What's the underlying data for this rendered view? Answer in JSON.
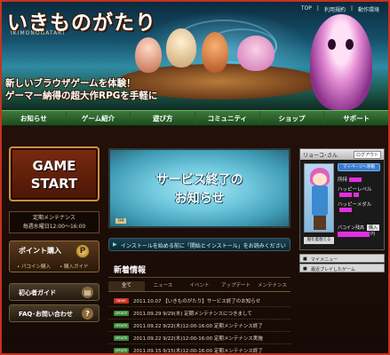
{
  "header": {
    "logo": "いきものがたり",
    "logo_sub": "IKIMONOGATARI",
    "top_links": [
      "TOP",
      "利用規約",
      "動作環境"
    ],
    "tagline1": "新しいブラウザゲームを体験！",
    "tagline2": "ゲーマー納得の超大作RPGを手軽に"
  },
  "nav": [
    "お知らせ",
    "ゲーム紹介",
    "遊び方",
    "コミュニティ",
    "ショップ",
    "サポート"
  ],
  "left": {
    "game_start_line1": "GAME",
    "game_start_line2": "START",
    "maintenance_title": "定期メンテナンス",
    "maintenance_time": "毎週水曜日12:00〜16:00",
    "point_label": "ポイント購入",
    "point_icon": "P",
    "point_sub1": "• パコイン購入",
    "point_sub2": "• 購入ガイド",
    "beginner_guide": "初心者ガイド",
    "faq": "FAQ･お問い合わせ"
  },
  "center": {
    "banner_line1": "サービス終了の",
    "banner_line2": "お知らせ",
    "banner_num": "04",
    "install_text": "インストールを始める前に「開始とインストール」をお読みください",
    "news_title": "新着情報",
    "tabs": [
      "全て",
      "ニュース",
      "イベント",
      "アップデート",
      "メンテナンス"
    ],
    "news": [
      {
        "badge": "NEWS",
        "color": "#c8321e",
        "text": "2011.10.07 【いきものがたり】サービス終了のお知らせ"
      },
      {
        "badge": "UPDATE",
        "color": "#3a8a3a",
        "text": "2011.09.29 9/29(木) 定期メンテナンスにつきまして"
      },
      {
        "badge": "UPDATE",
        "color": "#3a8a3a",
        "text": "2011.09.22 9/22(木)12:00-16:00 定期メンテナンス終了"
      },
      {
        "badge": "UPDATE",
        "color": "#3a8a3a",
        "text": "2011.09.22 9/22(木)12:00-16:00 定期メンテナンス実施"
      },
      {
        "badge": "UPDATE",
        "color": "#3a8a3a",
        "text": "2011.09.15 9/15(木)12:00-16:00 定期メンテナンス終了"
      }
    ]
  },
  "right": {
    "user_name": "リョーコ･さん",
    "logout": "ログアウト",
    "mypage": "マイページへ移動",
    "stat_money": "所持",
    "stat_happy_level": "ハッピーレベル",
    "stat_happy_medal": "ハッピーメダル",
    "coin_label": "パコイン残高",
    "coin_buy": "購入",
    "coin_unit": "円",
    "edit_avatar": "服を着替える",
    "menu1": "マイメニュー",
    "menu2": "最近プレイしたゲーム"
  }
}
